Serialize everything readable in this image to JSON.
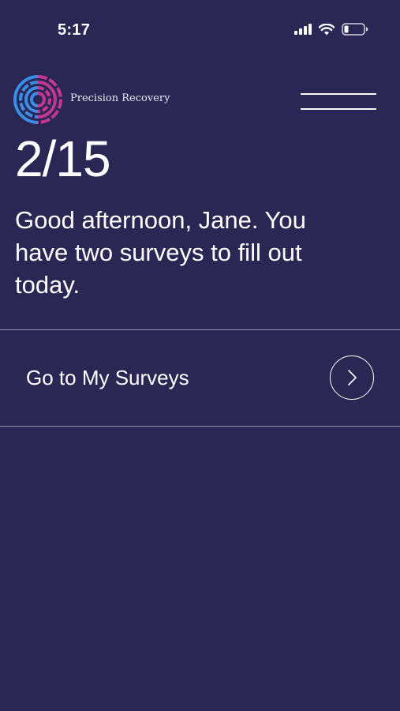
{
  "status_bar": {
    "time": "5:17",
    "icons": [
      "signal-icon",
      "wifi-icon",
      "battery-icon"
    ]
  },
  "header": {
    "brand_name": "Precision Recovery",
    "logo_colors": [
      "#3a8ee6",
      "#c2378f"
    ],
    "menu_icon": "hamburger-menu-icon"
  },
  "main": {
    "date": "2/15",
    "greeting": "Good afternoon, Jane. You have two surveys to fill out today."
  },
  "surveys_link": {
    "label": "Go to My Surveys",
    "icon": "chevron-right-circle-icon"
  },
  "colors": {
    "background": "#2a2754",
    "text": "#ffffff",
    "divider": "#9a98b6"
  }
}
